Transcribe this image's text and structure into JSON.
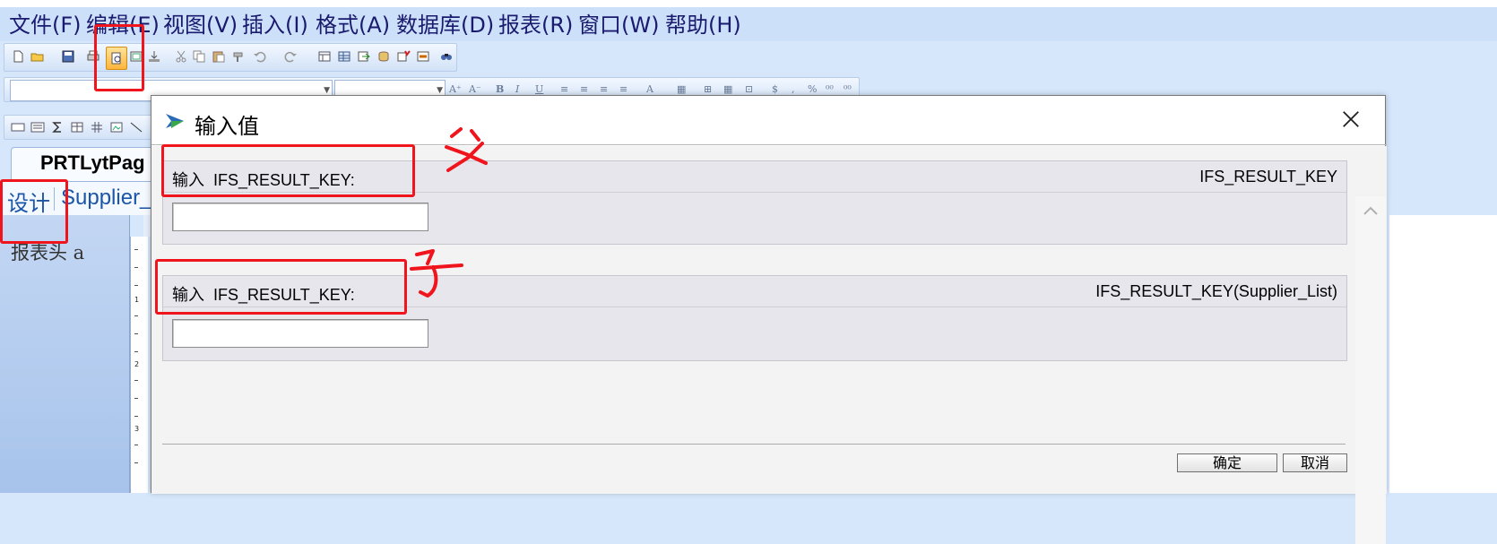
{
  "menu": {
    "items": [
      "文件(F)",
      "编辑(E)",
      "视图(V)",
      "插入(I)",
      "格式(A)",
      "数据库(D)",
      "报表(R)",
      "窗口(W)",
      "帮助(H)"
    ]
  },
  "toolbar": {
    "standard_icons": [
      "new-icon",
      "open-icon",
      "save-icon",
      "print-icon",
      "print-preview-icon",
      "page-setup-icon",
      "export-icon",
      "cut-icon",
      "copy-icon",
      "paste-icon",
      "format-painter-icon",
      "undo-icon",
      "redo-icon",
      "table-icon",
      "grid-icon",
      "insert-icon",
      "database-icon",
      "check-icon",
      "field-icon",
      "find-icon"
    ],
    "format_glyphs": [
      "A⁺",
      "A⁻",
      "B",
      "I",
      "U",
      "≡",
      "≡",
      "≡",
      "≡",
      "A",
      "▦",
      "⊞",
      "▦",
      "⊡",
      "$",
      ",",
      "%",
      "⁰⁰",
      "⁰⁰"
    ]
  },
  "document": {
    "tab_label": "PRTLytPag",
    "subtabs": [
      "设计",
      "Supplier_"
    ],
    "panel_text": "报表头 a",
    "ruler_numbers": [
      "1",
      "2",
      "3"
    ]
  },
  "dialog": {
    "title": "输入值",
    "params": [
      {
        "label": "输入  IFS_RESULT_KEY:",
        "name": "IFS_RESULT_KEY",
        "value": ""
      },
      {
        "label": "输入  IFS_RESULT_KEY:",
        "name": "IFS_RESULT_KEY(Supplier_List)",
        "value": ""
      }
    ],
    "ok_label": "确定",
    "cancel_label": "取消"
  },
  "annotations": {
    "color": "#f0141c",
    "handwritten": [
      "父",
      "子"
    ]
  },
  "colors": {
    "menu_bg": "#cde0fa",
    "accent_active": "#ffb53c",
    "dialog_panel": "#e7e6ec",
    "annotation_red": "#f0141c"
  }
}
